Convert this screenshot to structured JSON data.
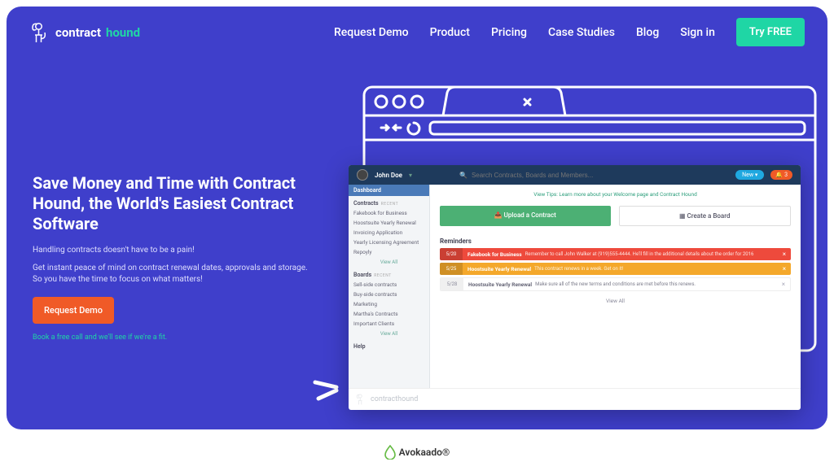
{
  "brand": {
    "part1": "contract",
    "part2": "hound"
  },
  "nav": {
    "items": [
      "Request Demo",
      "Product",
      "Pricing",
      "Case Studies",
      "Blog",
      "Sign in"
    ],
    "try": "Try FREE"
  },
  "hero": {
    "headline": "Save Money and Time with Contract Hound, the World's Easiest Contract Software",
    "sub1": "Handling contracts doesn't have to be a pain!",
    "sub2": "Get instant peace of mind on contract renewal dates, approvals and storage. So you have the time to focus on what matters!",
    "cta": "Request Demo",
    "book": "Book a free call and we'll see if we're a fit."
  },
  "app": {
    "user": "John Doe",
    "search_placeholder": "Search Contracts, Boards and Members...",
    "new_label": "New",
    "notif_count": "3",
    "sidebar": {
      "dashboard": "Dashboard",
      "contracts_head": "Contracts",
      "recent": "RECENT",
      "contracts": [
        "Fakebook for Business",
        "Hoostsuite Yearly Renewal",
        "Invoicing Application",
        "Yearly Licensing Agreement",
        "Repoyly"
      ],
      "boards_head": "Boards",
      "boards": [
        "Sell-side contracts",
        "Buy-side contracts",
        "Marketing",
        "Martha's Contracts",
        "Important Clients"
      ],
      "viewall": "View All",
      "help": "Help"
    },
    "tip": "View Tips: Learn more about your Welcome page and Contract Hound",
    "upload": "Upload a Contract",
    "create_board": "Create a Board",
    "reminders_title": "Reminders",
    "reminders": [
      {
        "date": "5/20",
        "name": "Fakebook for Business",
        "desc": "Remember to call John Walker at (919)555-4444. He'll fill in the additional details about the order for 2016",
        "color": "red"
      },
      {
        "date": "5/25",
        "name": "Hoostsuite Yearly Renewal",
        "desc": "This contract renews in a week. Get on it!",
        "color": "orange"
      },
      {
        "date": "5/28",
        "name": "Hoostsuite Yearly Renewal",
        "desc": "Make sure all of the new terms and conditions are met before this renews.",
        "color": "grey"
      }
    ],
    "viewall": "View All",
    "footer": "contracthound"
  },
  "page_footer": {
    "text": "Avokaado®"
  }
}
